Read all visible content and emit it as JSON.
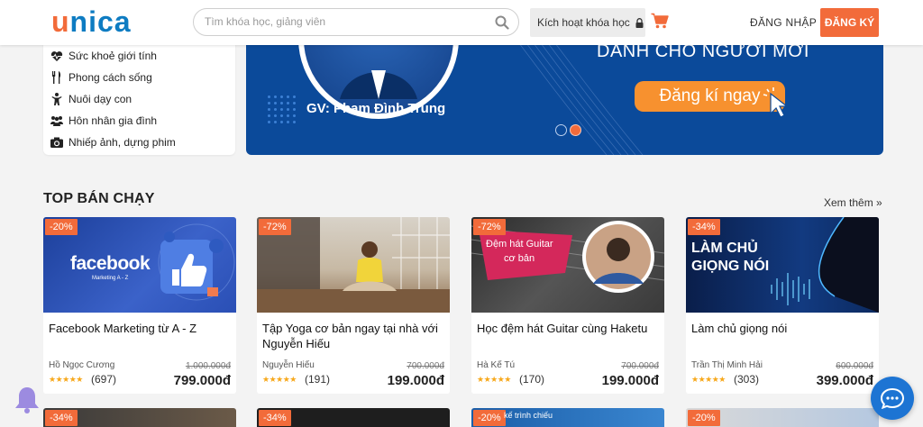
{
  "header": {
    "logo": {
      "u": "u",
      "rest": "nica"
    },
    "search_placeholder": "Tìm khóa học, giảng viên",
    "activate_label": "Kích hoạt khóa học",
    "login_label": "ĐĂNG NHẬP",
    "register_label": "ĐĂNG KÝ",
    "accent_color": "#f26b3a",
    "brand_color": "#0e7cc2"
  },
  "sidebar": {
    "items": [
      {
        "label": "Sức khoẻ giới tính",
        "icon": "heartbeat-icon"
      },
      {
        "label": "Phong cách sống",
        "icon": "cutlery-icon"
      },
      {
        "label": "Nuôi dạy con",
        "icon": "child-icon"
      },
      {
        "label": "Hôn nhân gia đình",
        "icon": "family-icon"
      },
      {
        "label": "Nhiếp ảnh, dựng phim",
        "icon": "camera-icon"
      }
    ]
  },
  "banner": {
    "teacher": "GV: Phạm Đình Trung",
    "headline": "DÀNH CHO NGƯỜI MỚI",
    "cta": "Đăng kí ngay"
  },
  "section": {
    "title": "TOP BÁN CHẠY",
    "see_more": "Xem thêm »"
  },
  "courses": [
    {
      "discount": "-20%",
      "thumb_text": "facebook",
      "thumb_sub": "Marketing A - Z",
      "title": "Facebook Marketing từ A - Z",
      "author": "Hồ Ngọc Cương",
      "old_price": "1.000.000đ",
      "reviews": "(697)",
      "price": "799.000đ"
    },
    {
      "discount": "-72%",
      "thumb_text": "",
      "thumb_sub": "",
      "title": "Tập Yoga cơ bản ngay tại nhà với Nguyễn Hiếu",
      "author": "Nguyễn Hiếu",
      "old_price": "700.000đ",
      "reviews": "(191)",
      "price": "199.000đ"
    },
    {
      "discount": "-72%",
      "thumb_text": "Đệm hát Guitar",
      "thumb_sub": "cơ bản",
      "title": "Học đệm hát Guitar cùng Haketu",
      "author": "Hà Kế Tú",
      "old_price": "700.000đ",
      "reviews": "(170)",
      "price": "199.000đ"
    },
    {
      "discount": "-34%",
      "thumb_text": "LÀM CHỦ",
      "thumb_sub": "GIỌNG NÓI",
      "title": "Làm chủ giọng nói",
      "author": "Trần Thị Minh Hải",
      "old_price": "600.000đ",
      "reviews": "(303)",
      "price": "399.000đ"
    }
  ],
  "next_row_badges": [
    "-34%",
    "-34%",
    "-20%",
    "-20%"
  ],
  "next_row_thumb_text": "kế trình chiếu"
}
